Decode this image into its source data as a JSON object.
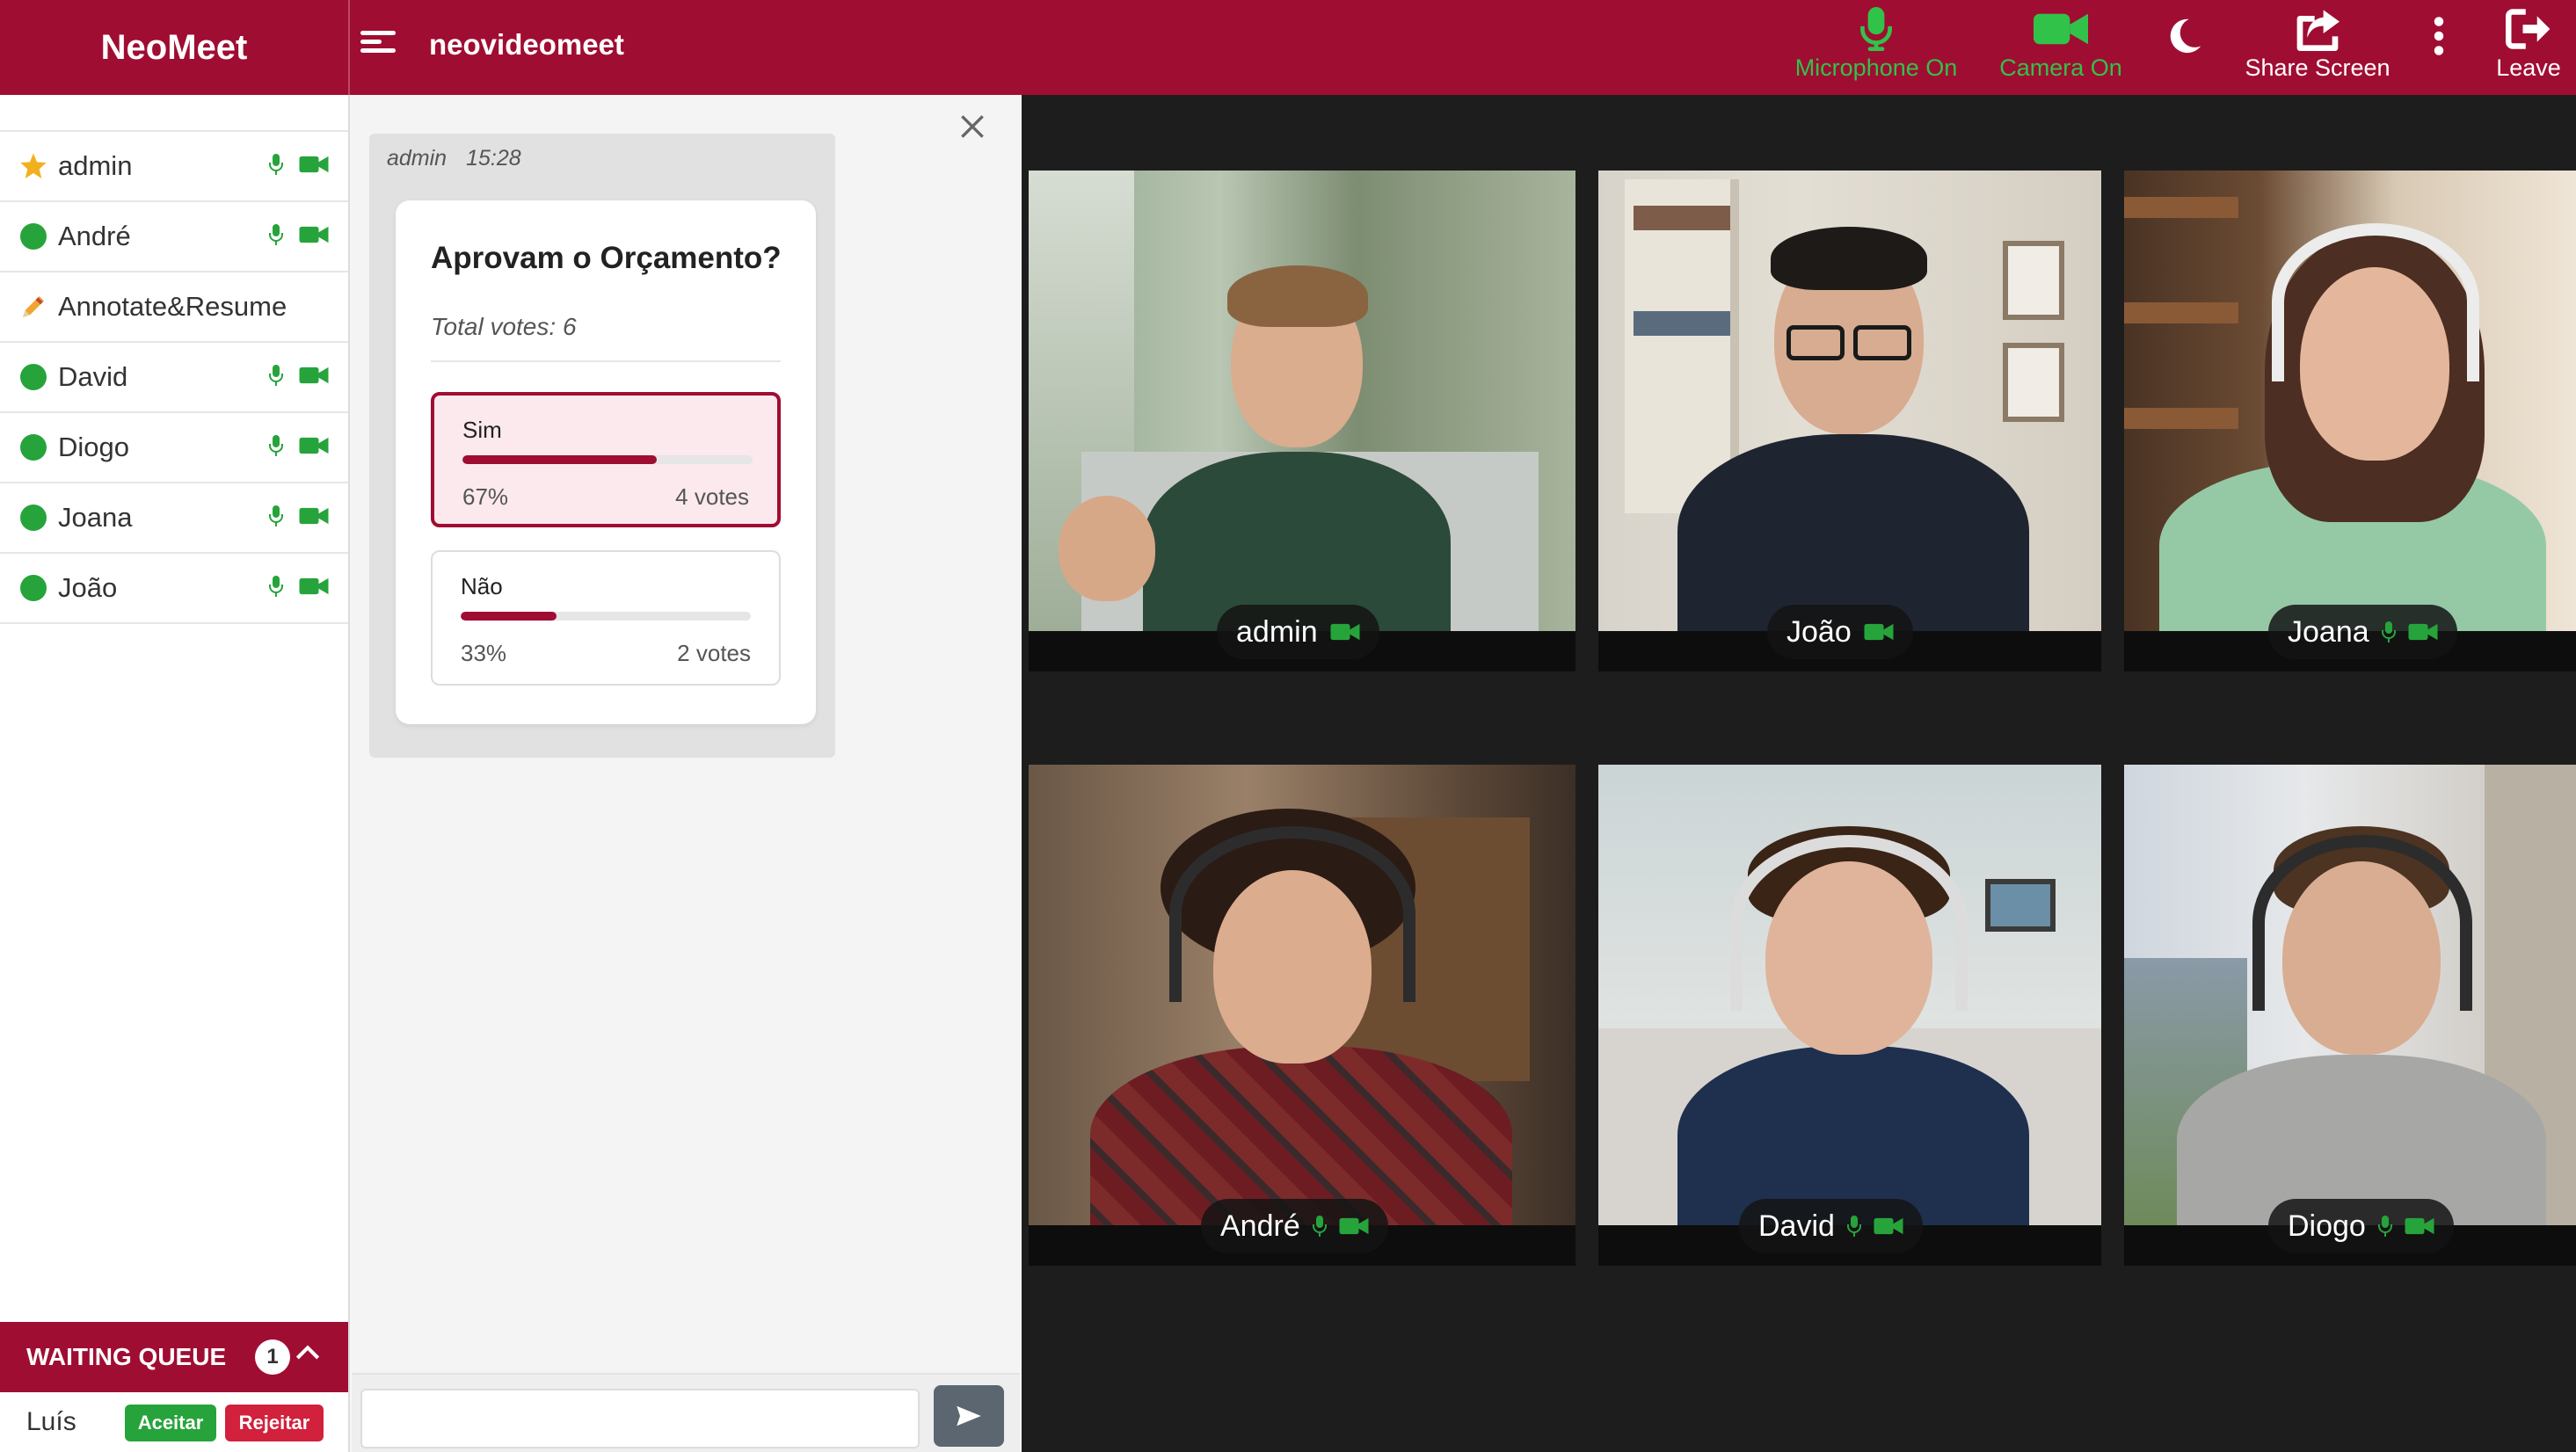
{
  "app": {
    "brand": "NeoMeet",
    "room": "neovideomeet"
  },
  "toolbar": {
    "microphone_label": "Microphone On",
    "camera_label": "Camera On",
    "share_label": "Share Screen",
    "leave_label": "Leave"
  },
  "participants": [
    {
      "name": "admin",
      "role": "host",
      "mic": true,
      "cam": true
    },
    {
      "name": "André",
      "mic": true,
      "cam": true
    },
    {
      "name": "Annotate&Resume",
      "role": "bot",
      "mic": false,
      "cam": false
    },
    {
      "name": "David",
      "mic": true,
      "cam": true
    },
    {
      "name": "Diogo",
      "mic": true,
      "cam": true
    },
    {
      "name": "Joana",
      "mic": true,
      "cam": true
    },
    {
      "name": "João",
      "mic": true,
      "cam": true
    }
  ],
  "queue": {
    "title": "WAITING QUEUE",
    "count": "1",
    "items": [
      {
        "name": "Luís",
        "accept": "Aceitar",
        "reject": "Rejeitar"
      }
    ]
  },
  "chat": {
    "message": {
      "author": "admin",
      "time": "15:28"
    },
    "poll": {
      "question": "Aprovam o Orçamento?",
      "total": "Total votes: 6",
      "options": [
        {
          "label": "Sim",
          "percent": "67%",
          "votes": "4 votes",
          "fraction": 0.67,
          "selected": true
        },
        {
          "label": "Não",
          "percent": "33%",
          "votes": "2 votes",
          "fraction": 0.33,
          "selected": false
        }
      ]
    },
    "input_placeholder": ""
  },
  "videos": [
    {
      "name": "admin",
      "mic": false,
      "cam": true
    },
    {
      "name": "João",
      "mic": false,
      "cam": true
    },
    {
      "name": "Joana",
      "mic": true,
      "cam": true
    },
    {
      "name": "André",
      "mic": true,
      "cam": true
    },
    {
      "name": "David",
      "mic": true,
      "cam": true
    },
    {
      "name": "Diogo",
      "mic": true,
      "cam": true
    }
  ],
  "colors": {
    "brand": "#a00d32",
    "green": "#26a43b",
    "reject": "#d1213c"
  }
}
